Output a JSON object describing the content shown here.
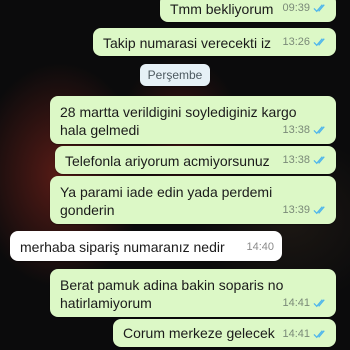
{
  "date_separator": "Perşembe",
  "messages": [
    {
      "text": "Tmm bekliyorum",
      "time": "09:39",
      "direction": "outgoing",
      "status": "read"
    },
    {
      "text": "Takip numarasi verecekti iz",
      "time": "13:26",
      "direction": "outgoing",
      "status": "read"
    },
    {
      "text": "28 martta verildigini soylediginiz kargo\nhala gelmedi",
      "time": "13:38",
      "direction": "outgoing",
      "status": "read"
    },
    {
      "text": "Telefonla ariyorum acmiyorsunuz",
      "time": "13:38",
      "direction": "outgoing",
      "status": "read"
    },
    {
      "text": "Ya parami iade edin yada perdemi\ngonderin",
      "time": "13:39",
      "direction": "outgoing",
      "status": "read"
    },
    {
      "text": "merhaba sipariş numaranız nedir",
      "time": "14:40",
      "direction": "incoming"
    },
    {
      "text": "Berat pamuk adina bakin soparis no\nhatirlamiyorum",
      "time": "14:41",
      "direction": "outgoing",
      "status": "read"
    },
    {
      "text": "Corum merkeze gelecek",
      "time": "14:41",
      "direction": "outgoing",
      "status": "read"
    }
  ],
  "colors": {
    "outgoing_bubble": "#dcf8c6",
    "incoming_bubble": "#ffffff",
    "read_ticks": "#4fb6ec"
  }
}
